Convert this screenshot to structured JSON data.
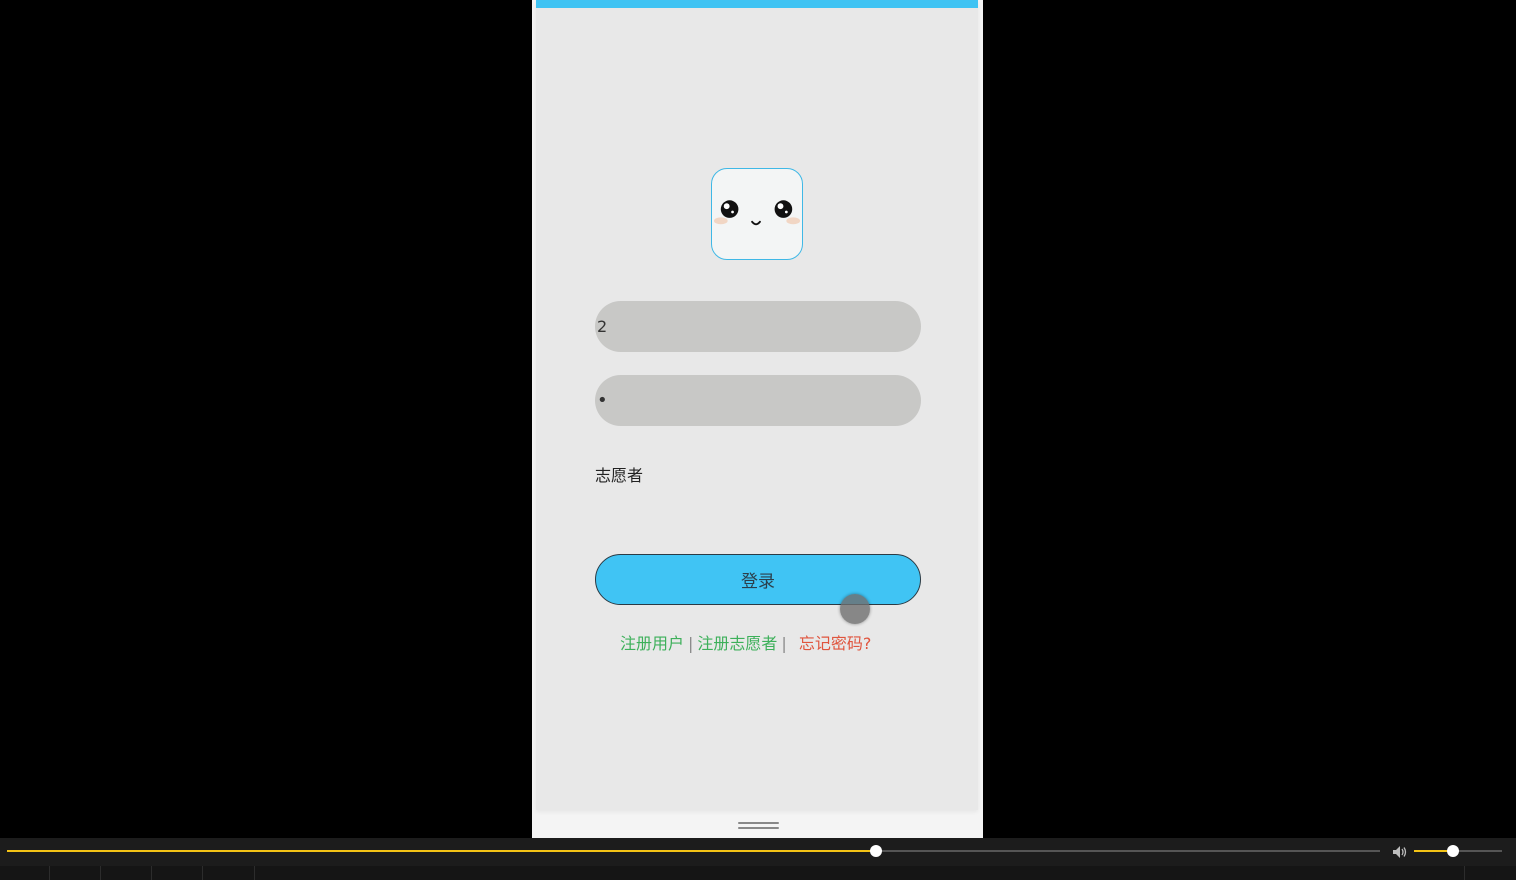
{
  "login_form": {
    "account_value": "2",
    "password_value": "•",
    "role_label": "志愿者",
    "login_button_label": "登录",
    "links": {
      "register_user": "注册用户",
      "separator_1": "|",
      "register_volunteer": "注册志愿者",
      "separator_2": "|",
      "forgot_password": "忘记密码?"
    }
  },
  "avatar": {
    "icon": "cute-face-icon",
    "border_color": "#3fb8e6"
  },
  "colors": {
    "accent": "#3fc3f3",
    "link_green": "#3db05a",
    "link_red": "#e0553e",
    "player_progress": "#f3c316"
  },
  "player": {
    "progress_fraction": 0.633,
    "volume_fraction": 0.44,
    "volume_icon": "speaker-icon"
  }
}
